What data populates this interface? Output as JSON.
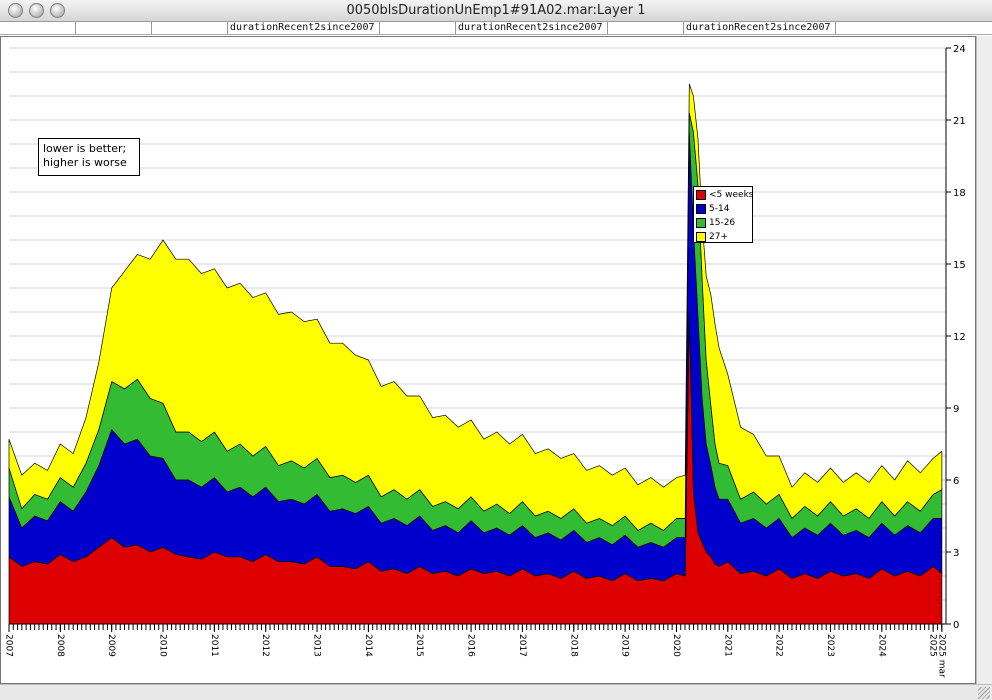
{
  "window": {
    "title": "0050blsDurationUnEmp1#91A02.mar:Layer 1"
  },
  "tabs": [
    {
      "label": "durationRecent2since2007"
    },
    {
      "label": "durationRecent2since2007"
    },
    {
      "label": "durationRecent2since2007"
    }
  ],
  "annotation": {
    "line1": "lower is better;",
    "line2": "higher is worse"
  },
  "chart_data": {
    "type": "area",
    "stacked": true,
    "title": "",
    "xlabel": "",
    "ylabel": "",
    "xlim": [
      2007.0,
      2025.25
    ],
    "ylim": [
      0,
      24
    ],
    "y_axis_position": "right",
    "y_ticks": [
      0,
      3,
      6,
      9,
      12,
      15,
      18,
      21,
      24
    ],
    "x_tick_labels": [
      "2007",
      "2008",
      "2009",
      "2010",
      "2011",
      "2012",
      "2013",
      "2014",
      "2015",
      "2016",
      "2017",
      "2018",
      "2019",
      "2020",
      "2021",
      "2022",
      "2023",
      "2024",
      "2025",
      "2025 mar"
    ],
    "grid": true,
    "legend_placement": "inside-center-right",
    "x": [
      2007.0,
      2007.25,
      2007.5,
      2007.75,
      2008.0,
      2008.25,
      2008.5,
      2008.75,
      2009.0,
      2009.25,
      2009.5,
      2009.75,
      2010.0,
      2010.25,
      2010.5,
      2010.75,
      2011.0,
      2011.25,
      2011.5,
      2011.75,
      2012.0,
      2012.25,
      2012.5,
      2012.75,
      2013.0,
      2013.25,
      2013.5,
      2013.75,
      2014.0,
      2014.25,
      2014.5,
      2014.75,
      2015.0,
      2015.25,
      2015.5,
      2015.75,
      2016.0,
      2016.25,
      2016.5,
      2016.75,
      2017.0,
      2017.25,
      2017.5,
      2017.75,
      2018.0,
      2018.25,
      2018.5,
      2018.75,
      2019.0,
      2019.25,
      2019.5,
      2019.75,
      2020.0,
      2020.17,
      2020.25,
      2020.33,
      2020.42,
      2020.5,
      2020.58,
      2020.67,
      2020.75,
      2020.83,
      2021.0,
      2021.25,
      2021.5,
      2021.75,
      2022.0,
      2022.25,
      2022.5,
      2022.75,
      2023.0,
      2023.25,
      2023.5,
      2023.75,
      2024.0,
      2024.25,
      2024.5,
      2024.75,
      2025.0,
      2025.17
    ],
    "series": [
      {
        "name": "<5 weeks",
        "color": "#dd0000",
        "values": [
          2.8,
          2.4,
          2.6,
          2.5,
          2.9,
          2.6,
          2.8,
          3.2,
          3.6,
          3.2,
          3.3,
          3.0,
          3.2,
          2.9,
          2.8,
          2.7,
          3.0,
          2.8,
          2.8,
          2.6,
          2.9,
          2.6,
          2.6,
          2.5,
          2.8,
          2.4,
          2.4,
          2.3,
          2.6,
          2.2,
          2.3,
          2.1,
          2.4,
          2.1,
          2.2,
          2.0,
          2.3,
          2.1,
          2.2,
          2.0,
          2.3,
          2.0,
          2.1,
          1.9,
          2.2,
          1.9,
          2.0,
          1.8,
          2.1,
          1.8,
          1.9,
          1.8,
          2.1,
          2.0,
          13.0,
          5.5,
          3.8,
          3.4,
          3.0,
          2.8,
          2.5,
          2.4,
          2.6,
          2.1,
          2.2,
          2.0,
          2.3,
          1.9,
          2.1,
          1.9,
          2.2,
          2.0,
          2.1,
          1.9,
          2.3,
          2.0,
          2.2,
          2.0,
          2.4,
          2.1
        ]
      },
      {
        "name": "5-14",
        "color": "#0000cc",
        "values": [
          2.5,
          1.6,
          1.9,
          1.8,
          2.2,
          2.1,
          2.7,
          3.4,
          4.5,
          4.3,
          4.4,
          4.0,
          3.7,
          3.1,
          3.2,
          3.0,
          3.1,
          2.7,
          2.9,
          2.7,
          2.8,
          2.5,
          2.6,
          2.5,
          2.6,
          2.3,
          2.4,
          2.3,
          2.3,
          2.0,
          2.1,
          2.0,
          2.1,
          1.8,
          1.9,
          1.8,
          2.0,
          1.7,
          1.8,
          1.7,
          1.8,
          1.6,
          1.7,
          1.6,
          1.7,
          1.5,
          1.6,
          1.5,
          1.6,
          1.4,
          1.5,
          1.4,
          1.5,
          1.6,
          7.5,
          11.0,
          9.0,
          6.0,
          4.5,
          3.8,
          3.2,
          2.8,
          2.6,
          2.1,
          2.2,
          2.0,
          2.1,
          1.7,
          1.9,
          1.8,
          2.0,
          1.7,
          1.8,
          1.7,
          1.9,
          1.7,
          1.9,
          1.8,
          2.0,
          2.3
        ]
      },
      {
        "name": "15-26",
        "color": "#33bb33",
        "values": [
          1.2,
          0.8,
          0.9,
          0.9,
          1.0,
          1.0,
          1.2,
          1.5,
          2.0,
          2.3,
          2.5,
          2.4,
          2.3,
          2.0,
          2.0,
          1.9,
          1.9,
          1.7,
          1.8,
          1.7,
          1.7,
          1.5,
          1.6,
          1.5,
          1.5,
          1.4,
          1.4,
          1.3,
          1.3,
          1.1,
          1.2,
          1.1,
          1.1,
          1.0,
          1.0,
          1.0,
          1.0,
          0.9,
          1.0,
          0.9,
          1.0,
          0.9,
          0.9,
          0.9,
          0.9,
          0.8,
          0.8,
          0.8,
          0.8,
          0.7,
          0.8,
          0.7,
          0.8,
          0.8,
          0.8,
          4.0,
          5.5,
          5.0,
          3.5,
          2.5,
          1.8,
          1.5,
          1.4,
          1.0,
          1.1,
          1.0,
          1.0,
          0.8,
          0.9,
          0.8,
          0.9,
          0.8,
          0.9,
          0.8,
          0.9,
          0.8,
          1.0,
          0.9,
          1.0,
          1.2
        ]
      },
      {
        "name": "27+",
        "color": "#ffff00",
        "values": [
          1.2,
          1.4,
          1.3,
          1.2,
          1.4,
          1.4,
          1.9,
          2.8,
          3.9,
          4.9,
          5.2,
          5.8,
          6.8,
          7.2,
          7.2,
          7.0,
          6.8,
          6.8,
          6.7,
          6.6,
          6.4,
          6.3,
          6.2,
          6.1,
          5.8,
          5.6,
          5.5,
          5.3,
          4.8,
          4.6,
          4.5,
          4.3,
          3.9,
          3.7,
          3.6,
          3.4,
          3.2,
          3.0,
          3.0,
          2.9,
          2.8,
          2.6,
          2.6,
          2.5,
          2.3,
          2.2,
          2.2,
          2.1,
          2.0,
          1.9,
          1.9,
          1.8,
          1.7,
          1.8,
          1.2,
          1.5,
          1.9,
          2.4,
          3.5,
          4.6,
          5.0,
          4.8,
          3.8,
          3.0,
          2.4,
          2.0,
          1.6,
          1.3,
          1.4,
          1.4,
          1.4,
          1.4,
          1.5,
          1.5,
          1.5,
          1.5,
          1.7,
          1.6,
          1.5,
          1.6
        ]
      }
    ]
  }
}
